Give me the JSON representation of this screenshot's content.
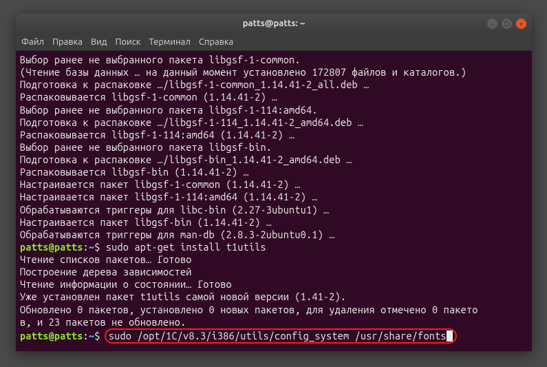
{
  "window": {
    "title": "patts@patts: ~"
  },
  "menu": {
    "file": "Файл",
    "edit": "Правка",
    "view": "Вид",
    "search": "Поиск",
    "terminal": "Терминал",
    "help": "Справка"
  },
  "prompt": {
    "userhost": "patts@patts",
    "colon": ":",
    "path": "~",
    "dollar": "$"
  },
  "output": {
    "l0": "Выбор ранее не выбранного пакета libgsf-1-common.",
    "l1": "(Чтение базы данных … на данный момент установлено 172807 файлов и каталогов.)",
    "l2": "Подготовка к распаковке …/libgsf-1-common_1.14.41-2_all.deb …",
    "l3": "Распаковывается libgsf-1-common (1.14.41-2) …",
    "l4": "Выбор ранее не выбранного пакета libgsf-1-114:amd64.",
    "l5": "Подготовка к распаковке …/libgsf-1-114_1.14.41-2_amd64.deb …",
    "l6": "Распаковывается libgsf-1-114:amd64 (1.14.41-2) …",
    "l7": "Выбор ранее не выбранного пакета libgsf-bin.",
    "l8": "Подготовка к распаковке …/libgsf-bin_1.14.41-2_amd64.deb …",
    "l9": "Распаковывается libgsf-bin (1.14.41-2) …",
    "l10": "Настраивается пакет libgsf-1-common (1.14.41-2) …",
    "l11": "Настраивается пакет libgsf-1-114:amd64 (1.14.41-2) …",
    "l12": "Обрабатываются триггеры для libc-bin (2.27-3ubuntu1) …",
    "l13": "Настраивается пакет libgsf-bin (1.14.41-2) …",
    "l14": "Обрабатываются триггеры для man-db (2.8.3-2ubuntu0.1) …",
    "cmd1": " sudo apt-get install t1utils",
    "l15": "Чтение списков пакетов… Готово",
    "l16": "Построение дерева зависимостей       ",
    "l17": "Чтение информации о состоянии… Готово",
    "l18": "Уже установлен пакет t1utils самой новой версии (1.41-2).",
    "l19": "Обновлено 0 пакетов, установлено 0 новых пакетов, для удаления отмечено 0 пакето",
    "l20": "в, и 23 пакетов не обновлено.",
    "cmd2": "sudo /opt/1C/v8.3/i386/utils/config_system /usr/share/fonts"
  }
}
